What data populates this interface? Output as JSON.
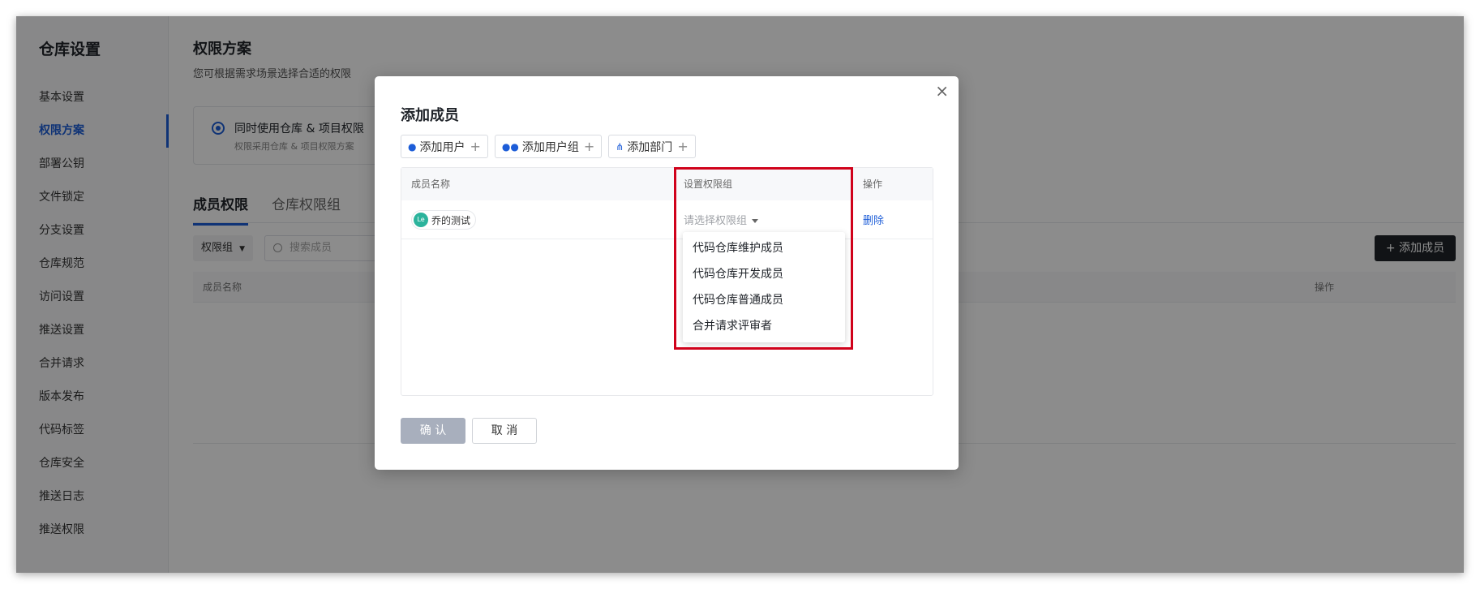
{
  "sidebar": {
    "title": "仓库设置",
    "items": [
      {
        "label": "基本设置",
        "active": false
      },
      {
        "label": "权限方案",
        "active": true
      },
      {
        "label": "部署公钥",
        "active": false
      },
      {
        "label": "文件锁定",
        "active": false
      },
      {
        "label": "分支设置",
        "active": false
      },
      {
        "label": "仓库规范",
        "active": false
      },
      {
        "label": "访问设置",
        "active": false
      },
      {
        "label": "推送设置",
        "active": false
      },
      {
        "label": "合并请求",
        "active": false
      },
      {
        "label": "版本发布",
        "active": false
      },
      {
        "label": "代码标签",
        "active": false
      },
      {
        "label": "仓库安全",
        "active": false
      },
      {
        "label": "推送日志",
        "active": false
      },
      {
        "label": "推送权限",
        "active": false
      }
    ]
  },
  "main": {
    "title": "权限方案",
    "description": "您可根据需求场景选择合适的权限",
    "scheme": {
      "label": "同时使用仓库 & 项目权限",
      "description": "权限采用仓库 & 项目权限方案"
    },
    "tabs": [
      {
        "label": "成员权限",
        "active": true
      },
      {
        "label": "仓库权限组",
        "active": false
      }
    ],
    "filter_label": "权限组",
    "search_placeholder": "搜索成员",
    "add_member_label": "添加成员",
    "table_headers": {
      "name": "成员名称",
      "action": "操作"
    }
  },
  "modal": {
    "title": "添加成员",
    "close_glyph": "×",
    "add_buttons": [
      {
        "label": "添加用户",
        "icon": "user-icon"
      },
      {
        "label": "添加用户组",
        "icon": "user-group-icon"
      },
      {
        "label": "添加部门",
        "icon": "org-tree-icon"
      }
    ],
    "table": {
      "headers": {
        "name": "成员名称",
        "group": "设置权限组",
        "action": "操作"
      },
      "rows": [
        {
          "avatar_text": "Le",
          "name": "乔的测试",
          "group_placeholder": "请选择权限组",
          "action": "删除"
        }
      ]
    },
    "dropdown_options": [
      "代码仓库维护成员",
      "代码仓库开发成员",
      "代码仓库普通成员",
      "合并请求评审者"
    ],
    "confirm_label": "确 认",
    "cancel_label": "取 消"
  },
  "colors": {
    "accent": "#1d5dd8",
    "highlight": "#d0021b",
    "avatar": "#2bb39c"
  }
}
